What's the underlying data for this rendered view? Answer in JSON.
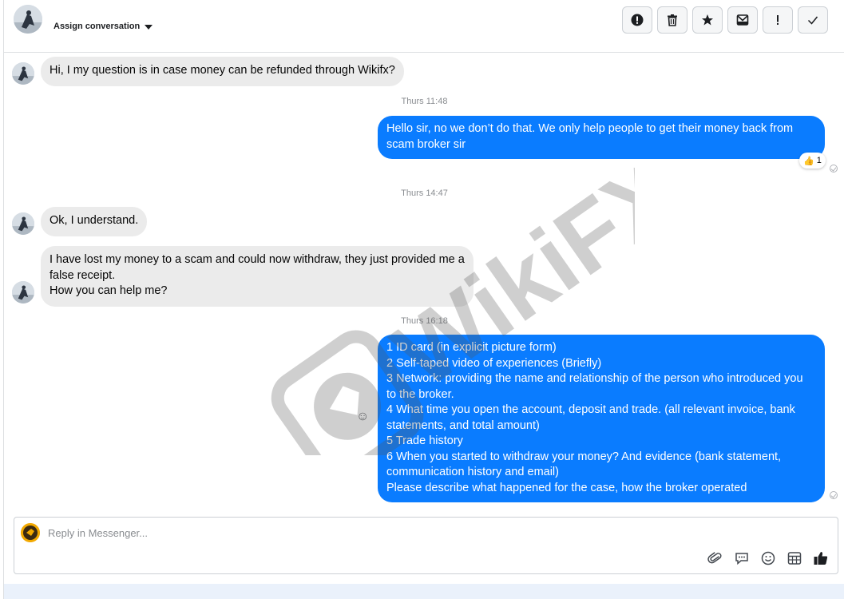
{
  "header": {
    "assign_label": "Assign conversation",
    "toolbar": [
      {
        "name": "report-button",
        "icon": "alert-circle-icon"
      },
      {
        "name": "delete-button",
        "icon": "trash-icon"
      },
      {
        "name": "star-button",
        "icon": "star-icon"
      },
      {
        "name": "mark-unread-button",
        "icon": "envelope-icon"
      },
      {
        "name": "important-button",
        "icon": "exclamation-icon"
      },
      {
        "name": "done-button",
        "icon": "check-icon"
      }
    ]
  },
  "messages": {
    "m1": "Hi, I my question is in case money can be refunded through Wikifx?",
    "t1": "Thurs 11:48",
    "m2_line1": "Hello sir, no we don’t do that. We only help people to get their money back from",
    "m2_line2": "scam broker sir",
    "reaction_emoji": "👍",
    "reaction_count": "1",
    "t2": "Thurs 14:47",
    "m3": "Ok, I understand.",
    "m4_line1": "I have lost my money to a scam and could now withdraw, they just provided me a",
    "m4_line2": "false receipt.",
    "m4_line3": "How you can help me?",
    "t3": "Thurs 16:18",
    "m5_lines": [
      "1 ID card (in explicit picture form)",
      "2 Self-taped video of experiences (Briefly)",
      "3 Network: providing the name and relationship of the person who introduced you",
      "to the broker.",
      "4 What time you open the account, deposit and trade. (all relevant invoice, bank",
      "statements, and total amount)",
      "5 Trade history",
      "6 When you started to withdraw your money? And evidence (bank statement,",
      "communication history and email)",
      "Please describe what happened for the case, how the broker operated"
    ]
  },
  "composer": {
    "placeholder": "Reply in Messenger..."
  },
  "watermark": {
    "text": "WikiFX"
  },
  "colors": {
    "outgoing_bubble": "#0a7cff",
    "incoming_bubble": "#ebebeb",
    "timestamp": "#8a8d91",
    "footer": "#eaf1fb"
  }
}
